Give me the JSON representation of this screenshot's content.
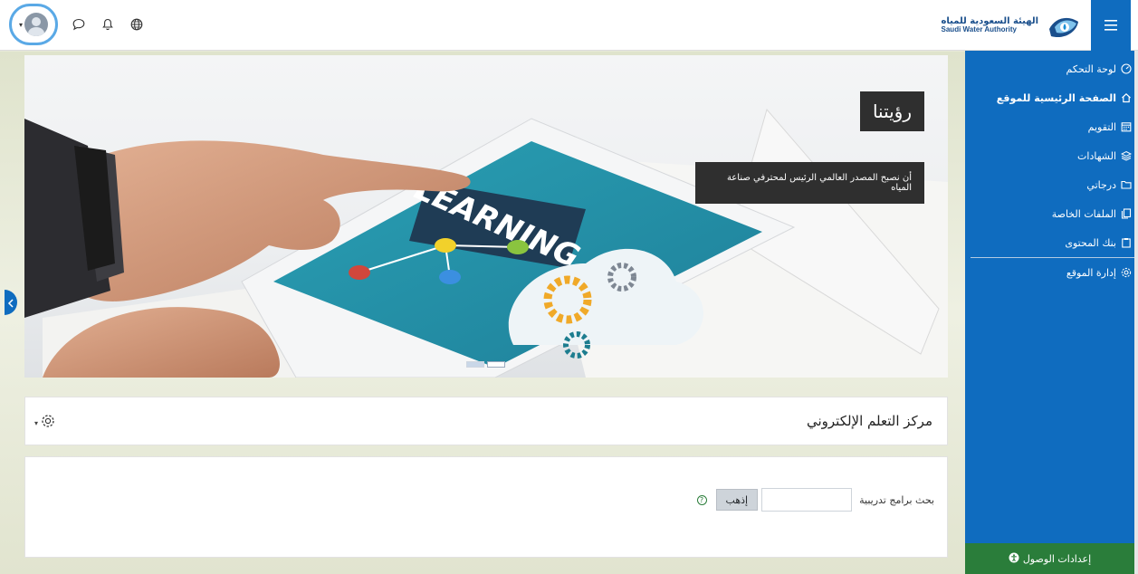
{
  "brand": {
    "name_ar": "الهيئة السعودية للمياه",
    "name_en": "Saudi Water Authority"
  },
  "icons": {
    "menu": "hamburger-icon",
    "messages": "chat-bubble-icon",
    "notifications": "bell-icon",
    "language": "globe-icon"
  },
  "sidebar": {
    "items": [
      {
        "label": "لوحة التحكم",
        "icon": "dashboard-gauge-icon"
      },
      {
        "label": "الصفحة الرئيسية للموقع",
        "icon": "home-icon"
      },
      {
        "label": "التقويم",
        "icon": "calendar-icon"
      },
      {
        "label": "الشهادات",
        "icon": "layers-icon"
      },
      {
        "label": "درجاتي",
        "icon": "folder-icon"
      },
      {
        "label": "الملفات الخاصة",
        "icon": "files-icon"
      },
      {
        "label": "بنك المحتوى",
        "icon": "clipboard-icon"
      }
    ],
    "admin": {
      "label": "إدارة الموقع",
      "icon": "gear-icon"
    },
    "access_settings": "إعدادات الوصول"
  },
  "carousel": {
    "title": "رؤيتنا",
    "text": "أن نصبح المصدر العالمي الرئيس لمحترفي صناعة المياه",
    "tablet_word": "LEARNING",
    "active_slide": 2,
    "slides": 2
  },
  "main": {
    "page_title": "مركز التعلم الإلكتروني",
    "search": {
      "label": "بحث برامج تدريبية",
      "button": "إذهب",
      "value": ""
    }
  },
  "colors": {
    "primary": "#0f6cbf",
    "access_bar": "#2a7d3a",
    "caption_bg": "#2f2f2f"
  }
}
